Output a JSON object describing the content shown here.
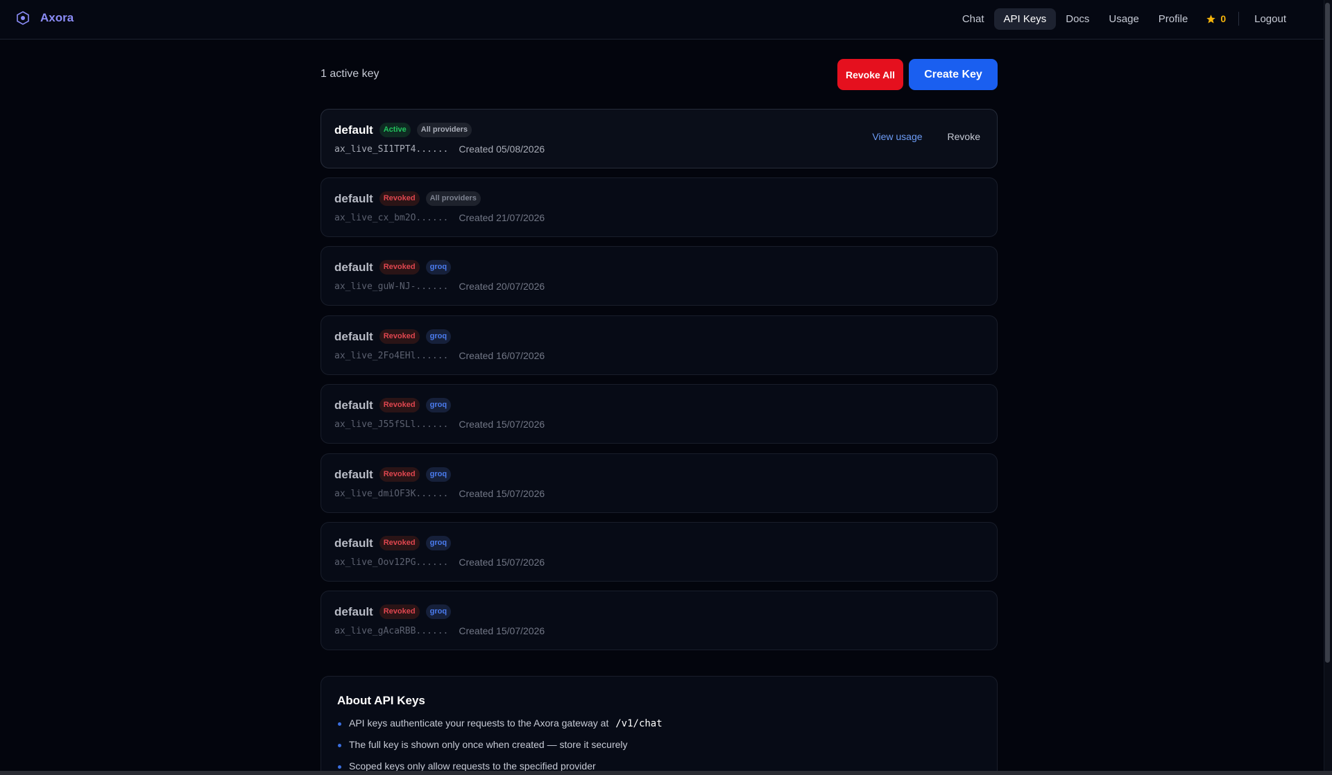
{
  "app": {
    "brand": "Axora"
  },
  "nav": {
    "items": [
      "Chat",
      "API Keys",
      "Docs",
      "Usage",
      "Profile"
    ],
    "active": "API Keys",
    "stars": "0",
    "logout": "Logout"
  },
  "header": {
    "active_count": "1 active key",
    "revoke_all": "Revoke All",
    "create_key": "Create Key"
  },
  "keys": [
    {
      "name": "default",
      "status": "Active",
      "scope": "All providers",
      "prefix": "ax_live_SI1TPT4......",
      "created": "Created 05/08/2026",
      "view_usage": "View usage",
      "revoke": "Revoke"
    },
    {
      "name": "default",
      "status": "Revoked",
      "scope": "All providers",
      "prefix": "ax_live_cx_bm2O......",
      "created": "Created 21/07/2026"
    },
    {
      "name": "default",
      "status": "Revoked",
      "scope": "groq",
      "prefix": "ax_live_guW-NJ-......",
      "created": "Created 20/07/2026"
    },
    {
      "name": "default",
      "status": "Revoked",
      "scope": "groq",
      "prefix": "ax_live_2Fo4EHl......",
      "created": "Created 16/07/2026"
    },
    {
      "name": "default",
      "status": "Revoked",
      "scope": "groq",
      "prefix": "ax_live_J55fSLl......",
      "created": "Created 15/07/2026"
    },
    {
      "name": "default",
      "status": "Revoked",
      "scope": "groq",
      "prefix": "ax_live_dmiOF3K......",
      "created": "Created 15/07/2026"
    },
    {
      "name": "default",
      "status": "Revoked",
      "scope": "groq",
      "prefix": "ax_live_Oov12PG......",
      "created": "Created 15/07/2026"
    },
    {
      "name": "default",
      "status": "Revoked",
      "scope": "groq",
      "prefix": "ax_live_gAcaRBB......",
      "created": "Created 15/07/2026"
    }
  ],
  "about": {
    "title": "About API Keys",
    "item1": "API keys authenticate your requests to the Axora gateway at",
    "item1_code": "/v1/chat",
    "item2": "The full key is shown only once when created — store it securely",
    "item3": "Scoped keys only allow requests to the specified provider"
  },
  "colors": {
    "background": "#03050d",
    "brand": "#8b8cf6",
    "primary": "#1a5ff0",
    "danger": "#e5101e",
    "active_badge": "#22c55e",
    "revoked_badge": "#e0464f",
    "star": "#f5b40b"
  },
  "icons": {
    "brand": "hexagon-logo-icon",
    "stars": "star-icon"
  }
}
